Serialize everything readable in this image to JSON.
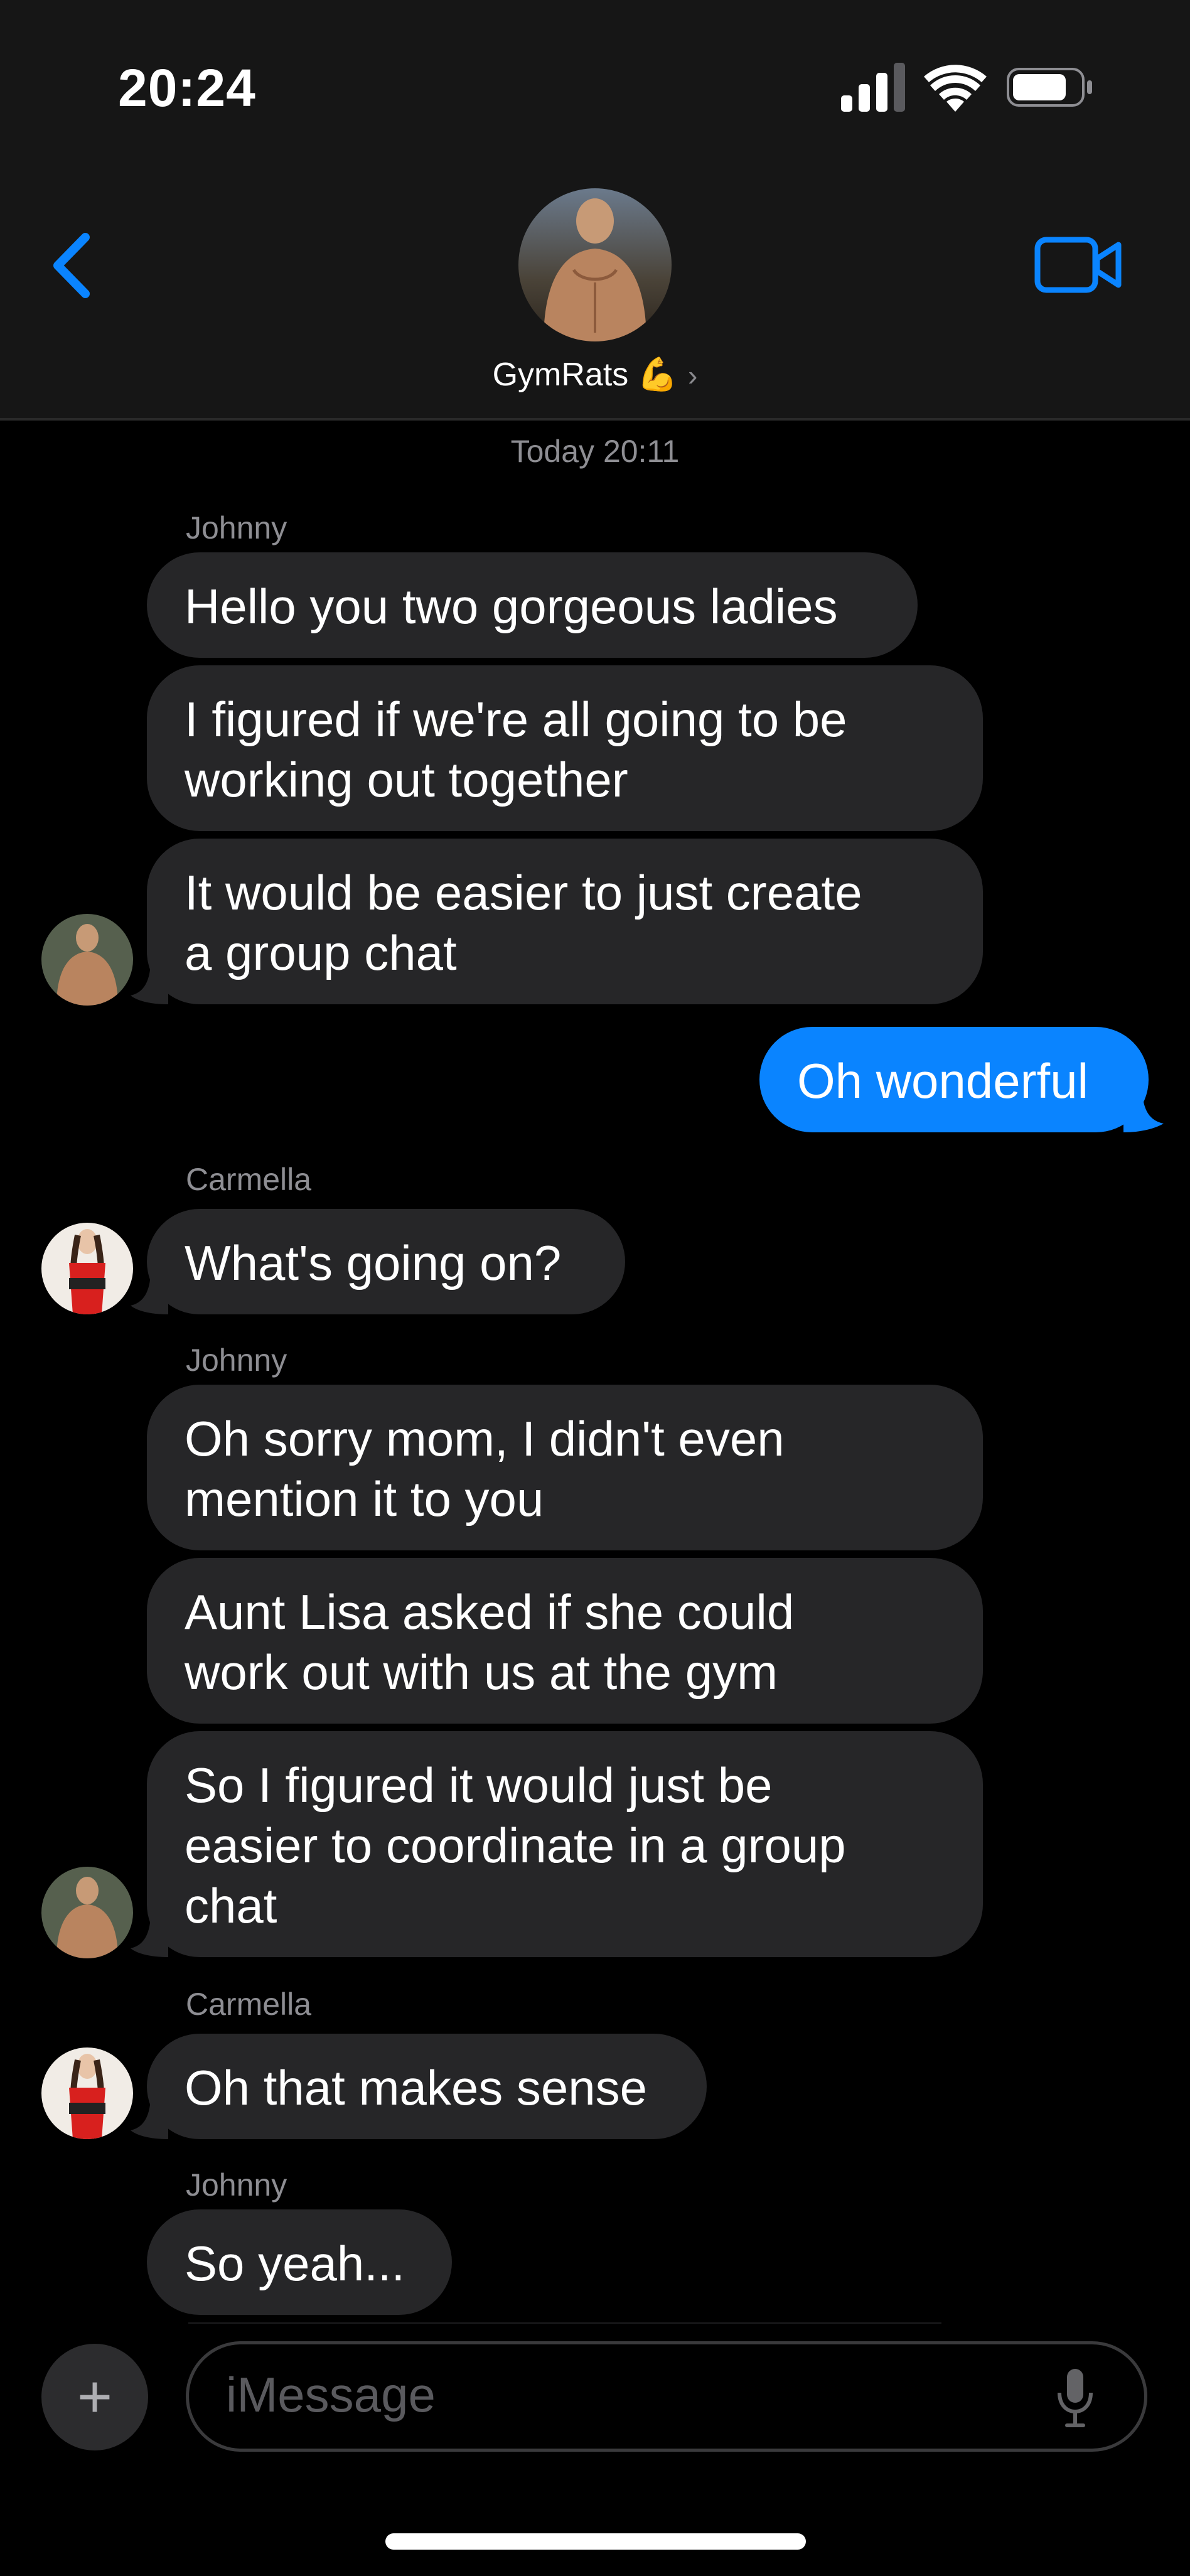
{
  "status": {
    "time": "20:24"
  },
  "header": {
    "group_name": "GymRats",
    "group_emoji": "💪",
    "chevron": "›"
  },
  "conversation": {
    "timestamp": "Today 20:11",
    "groups": [
      {
        "sender": "Johnny",
        "messages": [
          "Hello you two gorgeous ladies",
          "I figured if we're all going to be\nworking out together",
          "It would be easier to just create\na group chat"
        ]
      },
      {
        "sender": "me",
        "messages": [
          "Oh wonderful"
        ]
      },
      {
        "sender": "Carmella",
        "messages": [
          "What's going on?"
        ]
      },
      {
        "sender": "Johnny",
        "messages": [
          "Oh sorry mom, I didn't even\nmention it to you",
          "Aunt Lisa asked if she could\nwork out with us at the gym",
          "So I figured it would just be\neasier to coordinate in a group\nchat"
        ]
      },
      {
        "sender": "Carmella",
        "messages": [
          "Oh that makes sense"
        ]
      },
      {
        "sender": "Johnny",
        "messages": [
          "So yeah..."
        ]
      }
    ]
  },
  "composer": {
    "placeholder": "iMessage",
    "plus": "+"
  },
  "colors": {
    "accent": "#0a84ff",
    "incoming_bubble": "#262628",
    "background": "#000000"
  },
  "icons": [
    "back-chevron-icon",
    "video-camera-icon",
    "cellular-signal-icon",
    "wifi-icon",
    "battery-icon",
    "plus-icon",
    "microphone-icon"
  ]
}
